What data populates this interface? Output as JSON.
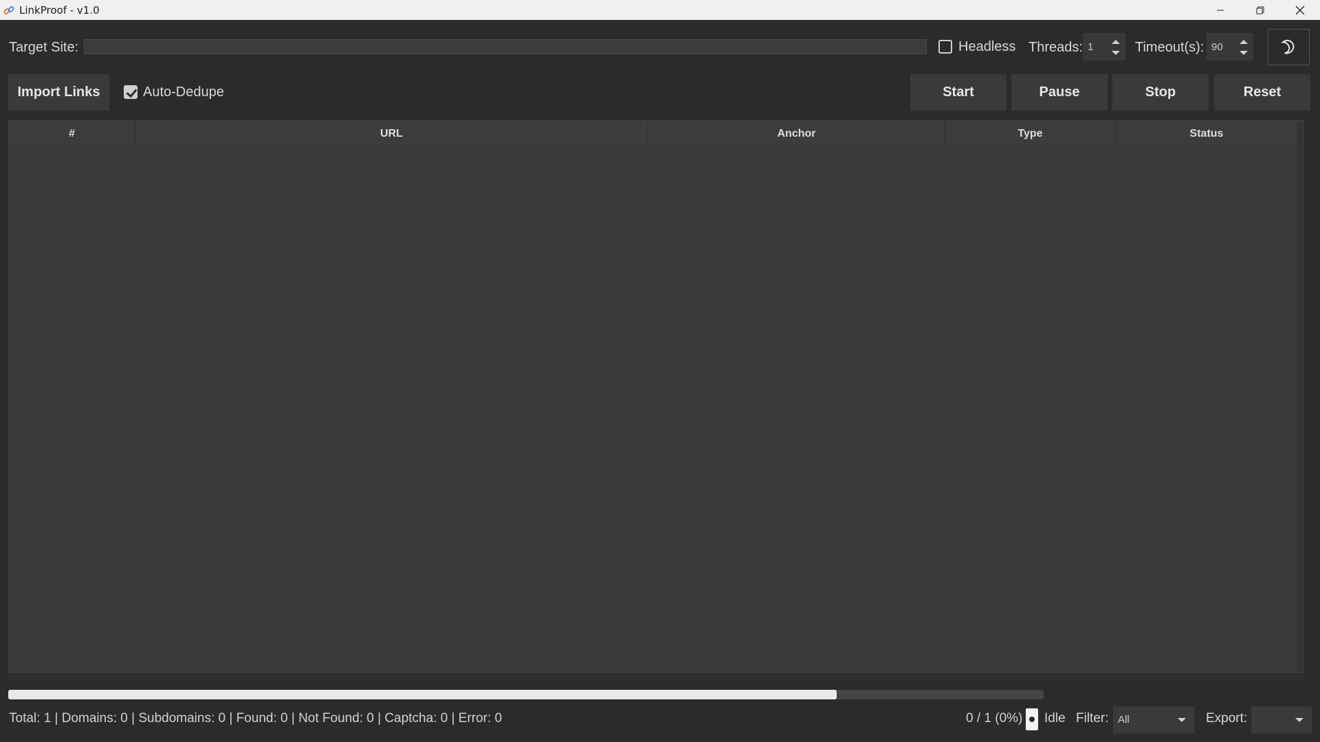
{
  "window": {
    "title": "LinkProof - v1.0"
  },
  "toolbar": {
    "target_label": "Target Site:",
    "target_value": "",
    "headless_label": "Headless",
    "headless_checked": false,
    "threads_label": "Threads:",
    "threads_value": "1",
    "timeout_label": "Timeout(s):",
    "timeout_value": "90",
    "theme_icon": "moon-icon"
  },
  "actions": {
    "import_label": "Import Links",
    "autodedupe_label": "Auto-Dedupe",
    "autodedupe_checked": true,
    "start_label": "Start",
    "pause_label": "Pause",
    "stop_label": "Stop",
    "reset_label": "Reset"
  },
  "table": {
    "columns": [
      "#",
      "URL",
      "Anchor",
      "Type",
      "Status"
    ],
    "rows": []
  },
  "progress": {
    "fraction": 0.8
  },
  "statusbar": {
    "summary": "Total: 1 | Domains: 0 | Subdomains: 0 | Found: 0 | Not Found: 0 | Captcha: 0 | Error: 0",
    "count": "0 / 1 (0%)",
    "state": "Idle",
    "filter_label": "Filter:",
    "filter_value": "All",
    "export_label": "Export:",
    "export_value": ""
  }
}
